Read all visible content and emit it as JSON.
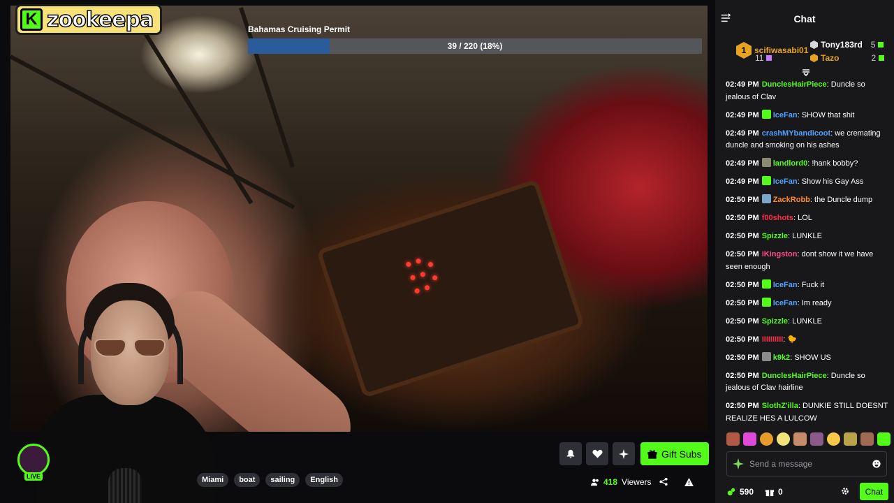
{
  "logo": {
    "letter": "K",
    "text": "zookeepa"
  },
  "progress": {
    "title": "Bahamas Cruising Permit",
    "label": "39 / 220 (18%)",
    "fraction": 0.18,
    "color": "#2a5c9c"
  },
  "stream": {
    "tags": [
      "Miami",
      "boat",
      "sailing",
      "English"
    ],
    "viewers_count": "418",
    "viewers_label": "Viewers",
    "gift_label": "Gift Subs",
    "live_label": "LIVE"
  },
  "chat": {
    "title": "Chat",
    "leaderboard": [
      {
        "name": "scifiwasabi01",
        "count": "11",
        "rank": "1",
        "color": "#e8a320"
      },
      {
        "name": "Tony183rd",
        "count": "5",
        "color": "#ffffff"
      },
      {
        "name": "Tazo",
        "count": "2",
        "color": "#e8a320"
      }
    ],
    "messages": [
      {
        "time": "02:49 PM",
        "user": "DunclesHairPiece",
        "color": "#53fc18",
        "badge": "",
        "text": "Duncle so jealous of Clav"
      },
      {
        "time": "02:49 PM",
        "user": "IceFan",
        "color": "#4fa3ff",
        "badge": "#53fc18",
        "text": "SHOW that shit"
      },
      {
        "time": "02:49 PM",
        "user": "crashMYbandicoot",
        "color": "#4fa3ff",
        "badge": "",
        "text": "we cremating duncle and smoking on his ashes"
      },
      {
        "time": "02:49 PM",
        "user": "landlord0",
        "color": "#53fc18",
        "badge": "#8a8a70",
        "text": "!hank bobby?"
      },
      {
        "time": "02:49 PM",
        "user": "IceFan",
        "color": "#4fa3ff",
        "badge": "#53fc18",
        "text": "Show his Gay Ass"
      },
      {
        "time": "02:50 PM",
        "user": "ZackRobb",
        "color": "#ff8c2a",
        "badge": "#7aa6c9",
        "text": "the Duncle dump"
      },
      {
        "time": "02:50 PM",
        "user": "f00shots",
        "color": "#ff2a4a",
        "badge": "",
        "text": "LOL"
      },
      {
        "time": "02:50 PM",
        "user": "Spizzle",
        "color": "#53fc18",
        "badge": "",
        "text": "LUNKLE"
      },
      {
        "time": "02:50 PM",
        "user": "iKingston",
        "color": "#ff4a8a",
        "badge": "",
        "text": "dont show it we have seen enough"
      },
      {
        "time": "02:50 PM",
        "user": "IceFan",
        "color": "#4fa3ff",
        "badge": "#53fc18",
        "text": "Fuck it"
      },
      {
        "time": "02:50 PM",
        "user": "IceFan",
        "color": "#4fa3ff",
        "badge": "#53fc18",
        "text": "Im ready"
      },
      {
        "time": "02:50 PM",
        "user": "Spizzle",
        "color": "#53fc18",
        "badge": "",
        "text": "LUNKLE"
      },
      {
        "time": "02:50 PM",
        "user": "IIIIIIIIII",
        "color": "#ff2a4a",
        "badge": "",
        "text": "🐤"
      },
      {
        "time": "02:50 PM",
        "user": "k9k2",
        "color": "#53fc18",
        "badge": "#8a8a8a",
        "text": "SHOW US"
      },
      {
        "time": "02:50 PM",
        "user": "DunclesHairPiece",
        "color": "#53fc18",
        "badge": "",
        "text": "Duncle so jealous of Clav hairline"
      },
      {
        "time": "02:50 PM",
        "user": "SlothZ'illa",
        "color": "#53fc18",
        "badge": "",
        "text": "DUNKIE STILL DOESNT REALIZE HES A LULCOW"
      }
    ],
    "input_placeholder": "Send a message",
    "kicks_count": "590",
    "gifts_count": "0",
    "chat_button": "Chat"
  },
  "colors": {
    "accent": "#53fc18",
    "panel": "#18181b"
  }
}
